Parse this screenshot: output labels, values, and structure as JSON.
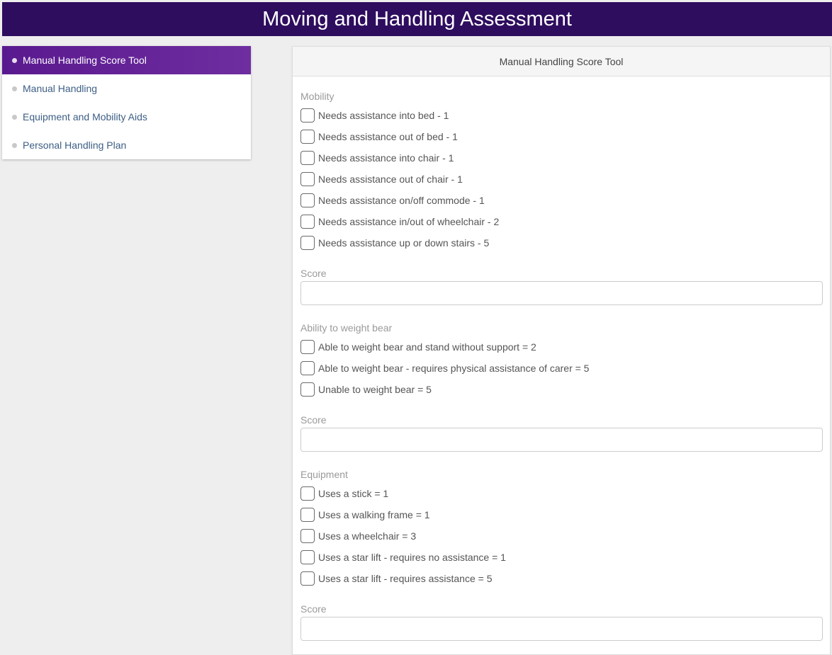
{
  "header": {
    "title": "Moving and Handling Assessment"
  },
  "sidebar": {
    "items": [
      {
        "label": "Manual Handling Score Tool"
      },
      {
        "label": "Manual Handling"
      },
      {
        "label": "Equipment and Mobility Aids"
      },
      {
        "label": "Personal Handling Plan"
      }
    ],
    "active_index": 0
  },
  "panel": {
    "title": "Manual Handling Score Tool",
    "sections": [
      {
        "title": "Mobility",
        "options": [
          "Needs assistance into bed - 1",
          "Needs assistance out of bed - 1",
          "Needs assistance into chair - 1",
          "Needs assistance out of chair - 1",
          "Needs assistance on/off commode - 1",
          "Needs assistance in/out of wheelchair - 2",
          "Needs assistance up or down stairs - 5"
        ],
        "score_label": "Score",
        "score_value": ""
      },
      {
        "title": "Ability to weight bear",
        "options": [
          "Able to weight bear and stand without support = 2",
          "Able to weight bear - requires physical assistance of carer = 5",
          "Unable to weight bear = 5"
        ],
        "score_label": "Score",
        "score_value": ""
      },
      {
        "title": "Equipment",
        "options": [
          "Uses a stick = 1",
          "Uses a walking frame = 1",
          "Uses a wheelchair = 3",
          "Uses a star lift - requires no assistance = 1",
          "Uses a star lift - requires assistance = 5"
        ],
        "score_label": "Score",
        "score_value": ""
      }
    ]
  },
  "colors": {
    "header_bg": "#2e0d5e",
    "active_item_bg": "#5a1a8f",
    "link_text": "#3d5e85"
  }
}
